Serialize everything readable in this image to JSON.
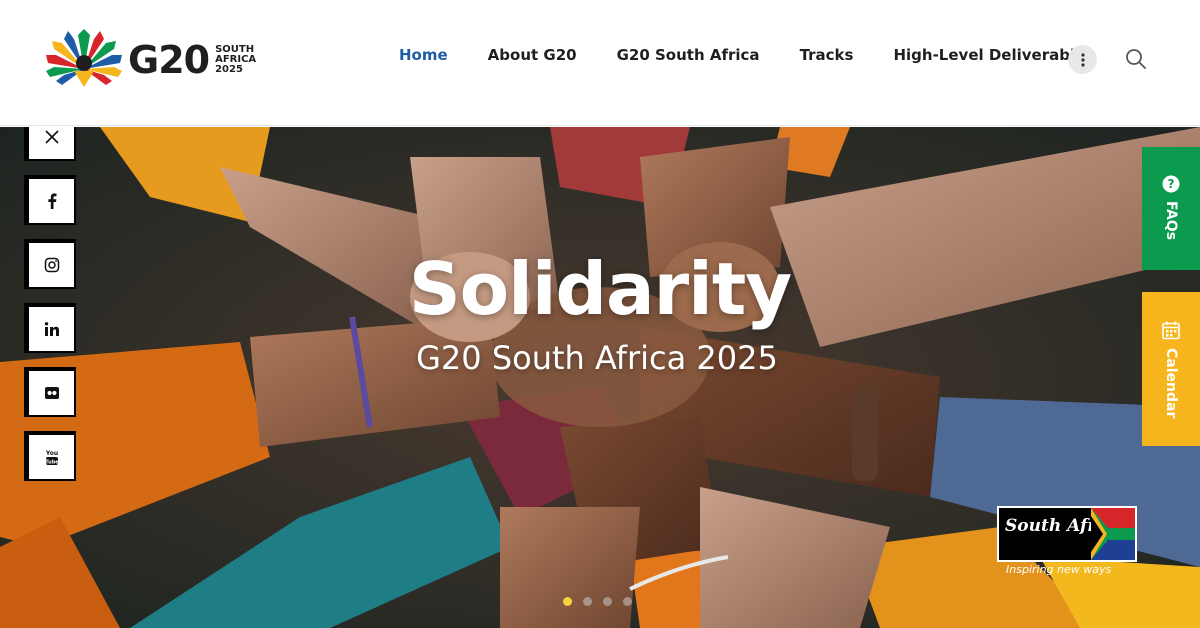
{
  "header": {
    "logo": {
      "wordmark": "G20",
      "subtitle_lines": [
        "SOUTH",
        "AFRICA",
        "2025"
      ]
    },
    "nav": [
      {
        "label": "Home",
        "active": true
      },
      {
        "label": "About G20",
        "active": false
      },
      {
        "label": "G20 South Africa",
        "active": false
      },
      {
        "label": "Tracks",
        "active": false
      },
      {
        "label": "High-Level Deliverables",
        "active": false
      }
    ],
    "more_icon": "vertical-dots-icon",
    "search_icon": "search-icon",
    "active_color": "#1f5ca8"
  },
  "hero": {
    "title": "Solidarity",
    "subtitle": "G20 South Africa 2025",
    "slides": 4,
    "active_slide": 1
  },
  "social": [
    {
      "name": "x",
      "icon": "x-icon"
    },
    {
      "name": "facebook",
      "icon": "facebook-icon"
    },
    {
      "name": "instagram",
      "icon": "instagram-icon"
    },
    {
      "name": "linkedin",
      "icon": "linkedin-icon"
    },
    {
      "name": "flickr",
      "icon": "flickr-icon"
    },
    {
      "name": "youtube",
      "icon": "youtube-icon"
    }
  ],
  "side_tabs": [
    {
      "label": "FAQs",
      "icon": "question-circle-icon",
      "color": "#0b9a4e"
    },
    {
      "label": "Calendar",
      "icon": "calendar-icon",
      "color": "#f6b51c"
    }
  ],
  "brand_badge": {
    "text": "South Africa",
    "tagline": "Inspiring new ways"
  }
}
